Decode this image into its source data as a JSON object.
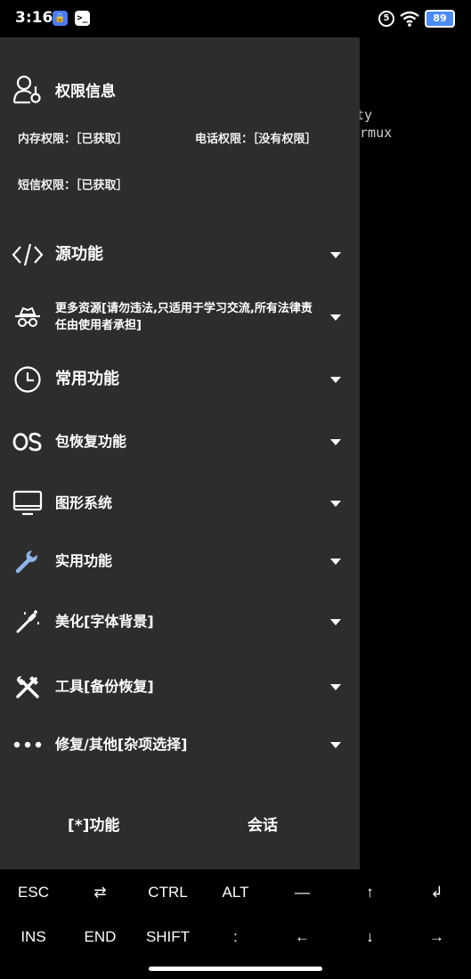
{
  "status_bar": {
    "time": "3:16",
    "notification_count": "5",
    "battery": "89"
  },
  "terminal": {
    "line1": "ty",
    "line2": "ermux"
  },
  "drawer": {
    "permissions": {
      "title": "权限信息",
      "storage": "内存权限：［已获取］",
      "phone": "电话权限：［没有权限］",
      "sms": "短信权限：［已获取］"
    },
    "menu": [
      {
        "label": "源功能",
        "icon": "code-icon"
      },
      {
        "label": "更多资源[请勿违法,只适用于学习交流,所有法律责任由使用者承担]",
        "icon": "spy-icon"
      },
      {
        "label": "常用功能",
        "icon": "clock-icon"
      },
      {
        "label": "包恢复功能",
        "icon": "os-icon"
      },
      {
        "label": "图形系统",
        "icon": "monitor-icon"
      },
      {
        "label": "实用功能",
        "icon": "wrench-icon"
      },
      {
        "label": "美化[字体背景]",
        "icon": "magic-wand-icon"
      },
      {
        "label": "工具[备份恢复]",
        "icon": "tools-icon"
      },
      {
        "label": "修复/其他[杂项选择]",
        "icon": "more-dots-icon"
      }
    ],
    "bottom": {
      "functions": "[*]功能",
      "session": "会话"
    }
  },
  "extra_keys": {
    "row1": [
      "ESC",
      "⇄",
      "CTRL",
      "ALT",
      "—",
      "↑",
      "↲"
    ],
    "row2": [
      "INS",
      "END",
      "SHIFT",
      ":",
      "←",
      "↓",
      "→"
    ]
  }
}
